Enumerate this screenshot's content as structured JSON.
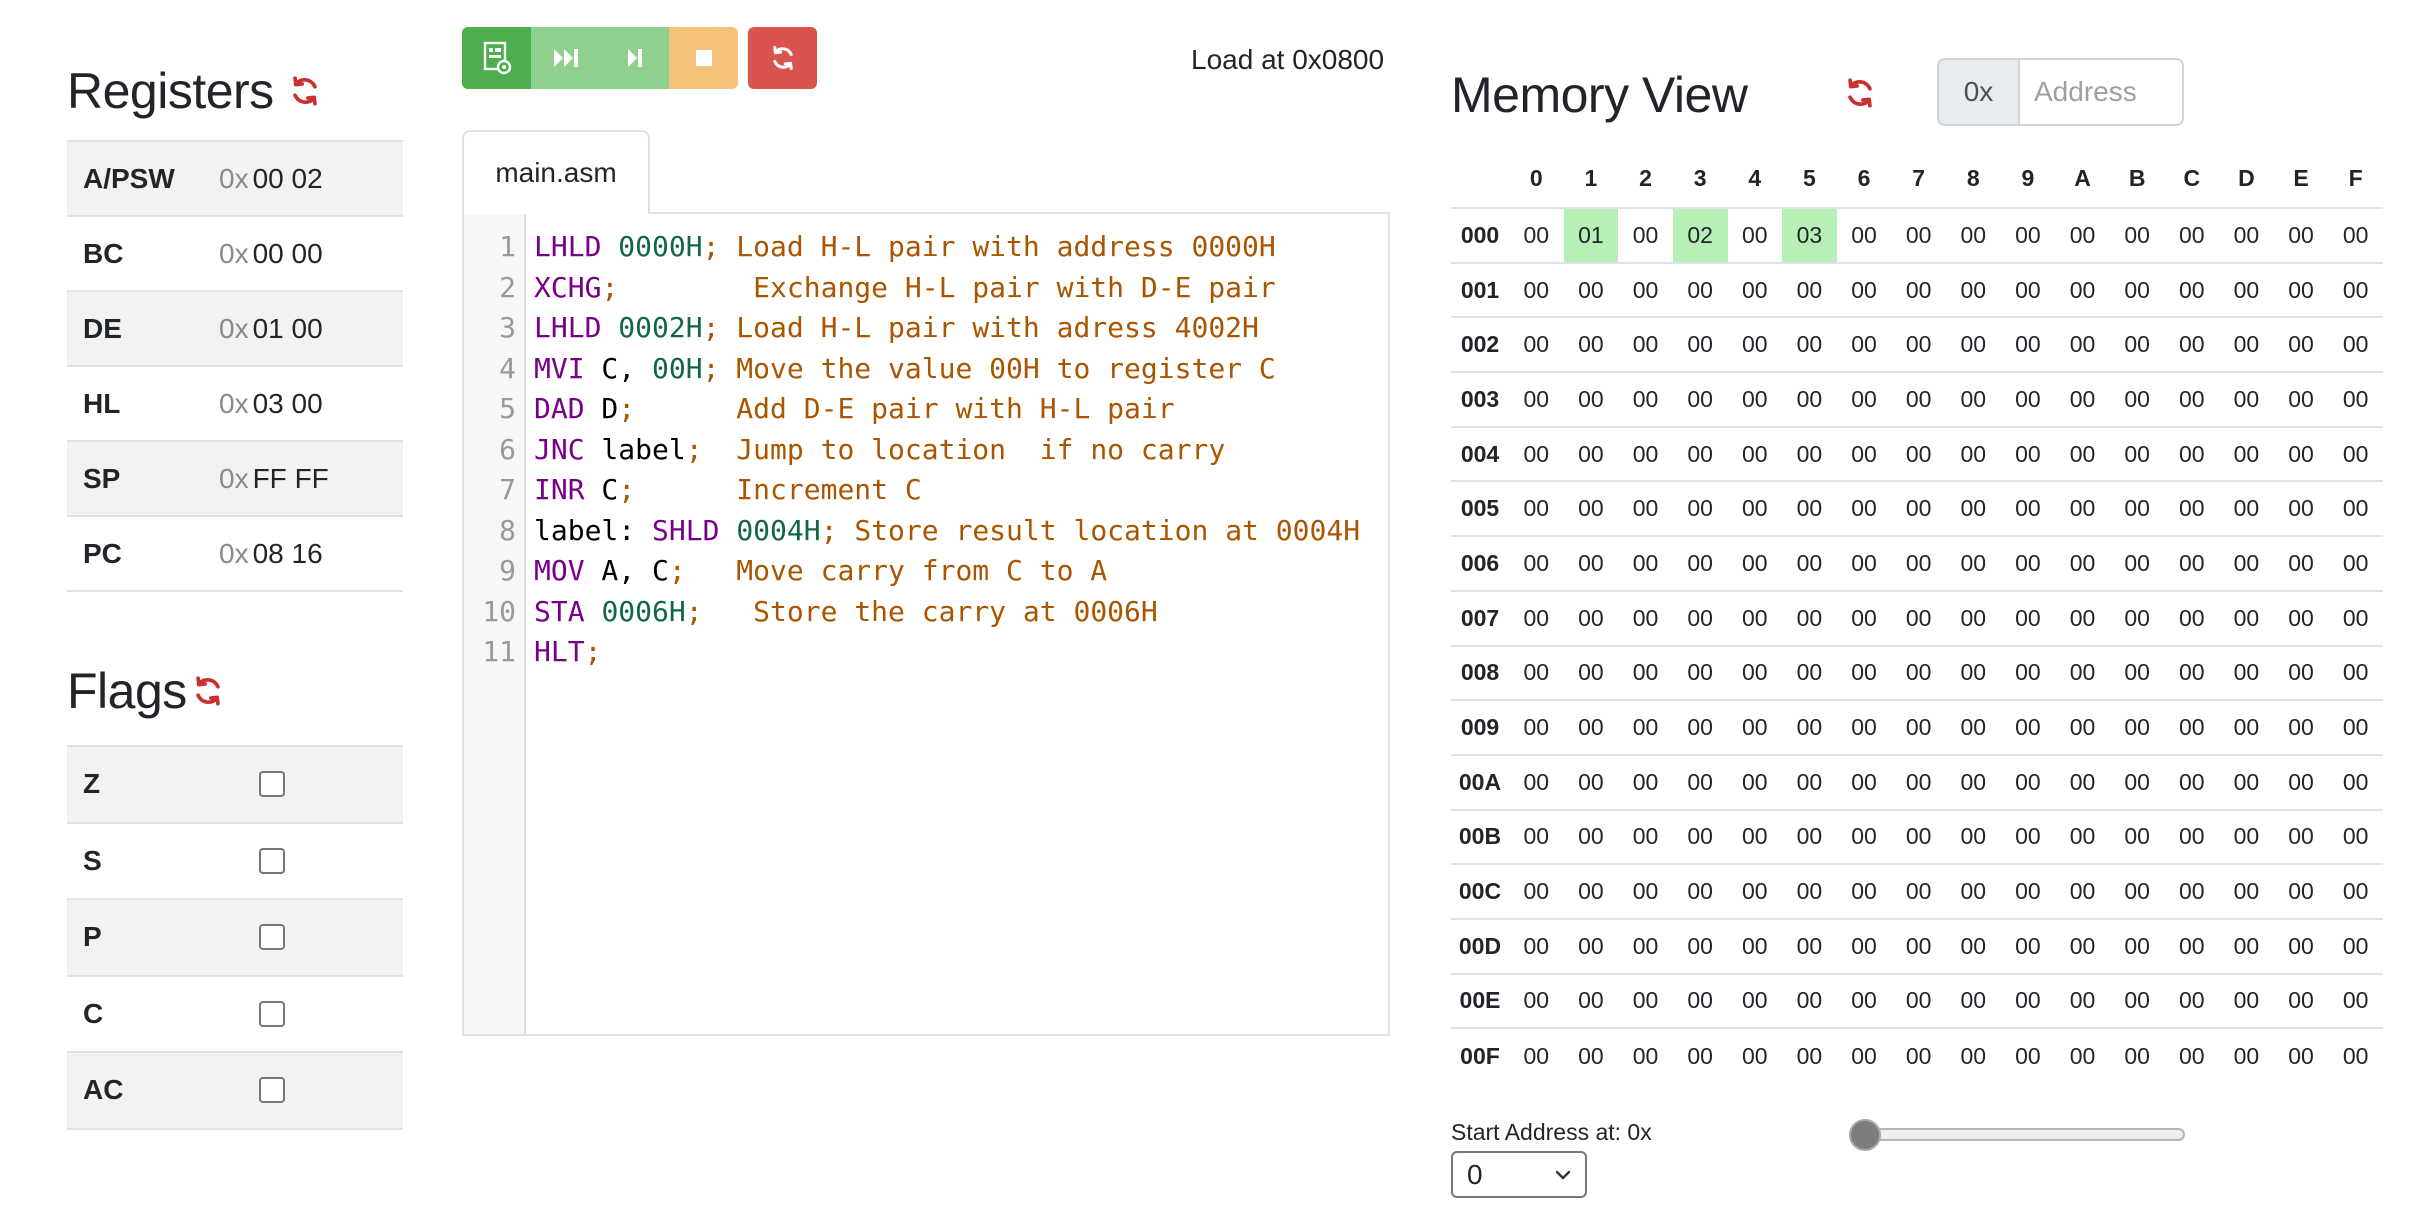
{
  "registers": {
    "title": "Registers",
    "prefix": "0x",
    "rows": [
      {
        "name": "A/PSW",
        "value": "00 02"
      },
      {
        "name": "BC",
        "value": "00 00"
      },
      {
        "name": "DE",
        "value": "01 00"
      },
      {
        "name": "HL",
        "value": "03 00"
      },
      {
        "name": "SP",
        "value": "FF FF"
      },
      {
        "name": "PC",
        "value": "08 16"
      }
    ]
  },
  "flags": {
    "title": "Flags",
    "rows": [
      {
        "name": "Z",
        "checked": false
      },
      {
        "name": "S",
        "checked": false
      },
      {
        "name": "P",
        "checked": false
      },
      {
        "name": "C",
        "checked": false
      },
      {
        "name": "AC",
        "checked": false
      }
    ]
  },
  "toolbar": {
    "load_label": "Load at 0x0800",
    "buttons": [
      "assemble-icon",
      "run-icon",
      "step-icon",
      "stop-icon",
      "reset-icon"
    ]
  },
  "editor": {
    "tab_label": "main.asm",
    "line_numbers": [
      "1",
      "2",
      "3",
      "4",
      "5",
      "6",
      "7",
      "8",
      "9",
      "10",
      "11"
    ],
    "lines": [
      [
        {
          "t": "LHLD",
          "c": "kw"
        },
        {
          "t": " "
        },
        {
          "t": "0000H",
          "c": "num"
        },
        {
          "t": "; Load H-L pair with address 0000H",
          "c": "cm"
        }
      ],
      [
        {
          "t": "XCHG",
          "c": "kw"
        },
        {
          "t": ";        Exchange H-L pair with D-E pair",
          "c": "cm"
        }
      ],
      [
        {
          "t": "LHLD",
          "c": "kw"
        },
        {
          "t": " "
        },
        {
          "t": "0002H",
          "c": "num"
        },
        {
          "t": "; Load H-L pair with adress 4002H",
          "c": "cm"
        }
      ],
      [
        {
          "t": "MVI",
          "c": "kw"
        },
        {
          "t": " C, "
        },
        {
          "t": "00H",
          "c": "num"
        },
        {
          "t": "; Move the value 00H to register C",
          "c": "cm"
        }
      ],
      [
        {
          "t": "DAD",
          "c": "kw"
        },
        {
          "t": " D"
        },
        {
          "t": ";      Add D-E pair with H-L pair",
          "c": "cm"
        }
      ],
      [
        {
          "t": "JNC",
          "c": "kw"
        },
        {
          "t": " label"
        },
        {
          "t": ";  Jump to location  if no carry",
          "c": "cm"
        }
      ],
      [
        {
          "t": "INR",
          "c": "kw"
        },
        {
          "t": " C"
        },
        {
          "t": ";      Increment C",
          "c": "cm"
        }
      ],
      [
        {
          "t": "label: "
        },
        {
          "t": "SHLD",
          "c": "kw"
        },
        {
          "t": " "
        },
        {
          "t": "0004H",
          "c": "num"
        },
        {
          "t": "; Store result location at 0004H",
          "c": "cm"
        }
      ],
      [
        {
          "t": "MOV",
          "c": "kw"
        },
        {
          "t": " A, C"
        },
        {
          "t": ";   Move carry from C to A",
          "c": "cm"
        }
      ],
      [
        {
          "t": "STA",
          "c": "kw"
        },
        {
          "t": " "
        },
        {
          "t": "0006H",
          "c": "num"
        },
        {
          "t": ";   Store the carry at 0006H",
          "c": "cm"
        }
      ],
      [
        {
          "t": "HLT",
          "c": "kw"
        },
        {
          "t": ";",
          "c": "cm"
        }
      ]
    ]
  },
  "memory": {
    "title": "Memory View",
    "addr_prefix": "0x",
    "addr_placeholder": "Address",
    "columns": [
      "0",
      "1",
      "2",
      "3",
      "4",
      "5",
      "6",
      "7",
      "8",
      "9",
      "A",
      "B",
      "C",
      "D",
      "E",
      "F"
    ],
    "row_labels": [
      "000",
      "001",
      "002",
      "003",
      "004",
      "005",
      "006",
      "007",
      "008",
      "009",
      "00A",
      "00B",
      "00C",
      "00D",
      "00E",
      "00F"
    ],
    "default_value": "00",
    "nonzero": {
      "000": {
        "1": "01",
        "3": "02",
        "5": "03"
      }
    },
    "highlighted": {
      "000": [
        "1",
        "3",
        "5"
      ]
    },
    "start_label": "Start Address at: 0x",
    "start_value": "0",
    "slider_fraction": 0
  },
  "colors": {
    "green": "#4cae4c",
    "light_green": "#8fd08f",
    "orange": "#f5c27c",
    "red": "#d9534f",
    "refresh_red": "#c9302c",
    "keyword": "#770088",
    "number": "#116644",
    "comment": "#aa5500",
    "highlight": "#b6f0b6"
  }
}
